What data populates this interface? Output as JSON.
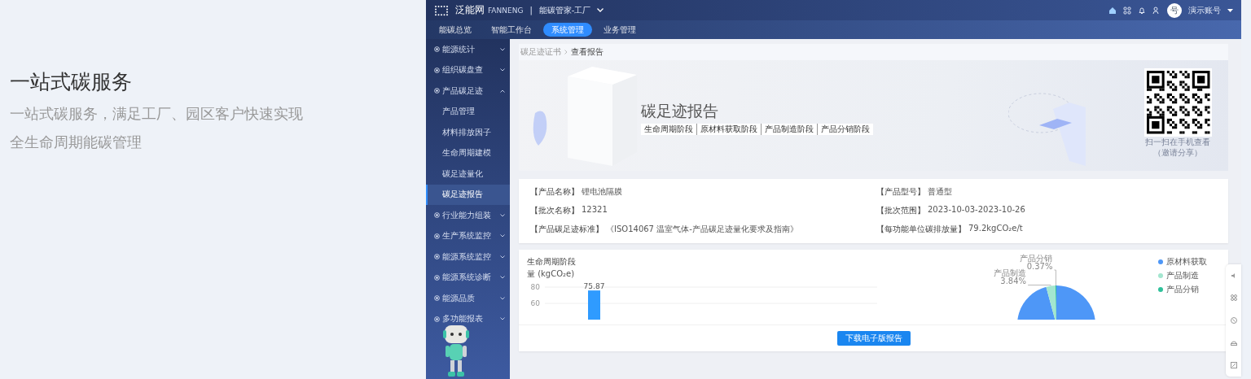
{
  "intro": {
    "title": "一站式碳服务",
    "description": "一站式碳服务，满足工厂、园区客户快速实现全生命周期能碳管理"
  },
  "app": {
    "top_bar": {
      "logo_text": "泛能网",
      "logo_subtitle": "FANNENG",
      "separator": "|",
      "workspace": "能碳管家-工厂",
      "avatar_text": "号",
      "account": "演示账号"
    },
    "nav_tabs": [
      {
        "label": "能碳总览",
        "selected": false
      },
      {
        "label": "智能工作台",
        "selected": false
      },
      {
        "label": "系统管理",
        "selected": true
      },
      {
        "label": "业务管理",
        "selected": false
      }
    ],
    "sidebar": {
      "items": [
        {
          "label": "能源统计",
          "expanded": false
        },
        {
          "label": "组织碳盘查",
          "expanded": false
        },
        {
          "label": "产品碳足迹",
          "expanded": true,
          "children": [
            {
              "label": "产品管理",
              "selected": false
            },
            {
              "label": "材料排放因子",
              "selected": false
            },
            {
              "label": "生命周期建模",
              "selected": false
            },
            {
              "label": "碳足迹量化",
              "selected": false
            },
            {
              "label": "碳足迹报告",
              "selected": true
            }
          ]
        },
        {
          "label": "行业能力组装",
          "expanded": false
        },
        {
          "label": "生产系统监控",
          "expanded": false
        },
        {
          "label": "能源系统监控",
          "expanded": false
        },
        {
          "label": "能源系统诊断",
          "expanded": false
        },
        {
          "label": "能源品质",
          "expanded": false
        },
        {
          "label": "多功能报表",
          "expanded": false
        }
      ]
    },
    "breadcrumb": [
      "碳足迹证书",
      "查看报告"
    ],
    "banner": {
      "title": "碳足迹报告",
      "stages": [
        "生命周期阶段",
        "原材料获取阶段",
        "产品制造阶段",
        "产品分销阶段"
      ],
      "qr_caption": "扫一扫在手机查看",
      "qr_subcaption": "（邀请分享）"
    },
    "info_fields": [
      {
        "label": "【产品名称】",
        "value": "锂电池隔膜"
      },
      {
        "label": "【产品型号】",
        "value": "普通型"
      },
      {
        "label": "【批次名称】",
        "value": "12321"
      },
      {
        "label": "【批次范围】",
        "value": "2023-10-03-2023-10-26"
      },
      {
        "label": "【产品碳足迹标准】",
        "value": "《ISO14067 温室气体-产品碳足迹量化要求及指南》"
      },
      {
        "label": "【每功能单位碳排放量】",
        "value": "79.2kgCO₂e/t"
      }
    ],
    "lifecycle_section": {
      "title": "生命周期阶段",
      "bar_chart": {
        "chart_data": {
          "type": "bar",
          "ylabel": "量 (kgCO₂e)",
          "values": [
            75.87
          ],
          "ylim": [
            40,
            80
          ],
          "yticks": [
            60,
            80
          ],
          "data_labels": true
        }
      },
      "pie_chart": {
        "chart_data": {
          "type": "pie",
          "categories": [
            "原材料获取",
            "产品制造",
            "产品分销"
          ],
          "values": [
            95.79,
            3.84,
            0.37
          ],
          "colors": [
            "#4e97f7",
            "#a3e6cf",
            "#2fc19a"
          ],
          "value_labels": [
            null,
            "3.84%",
            "0.37%"
          ]
        }
      }
    },
    "download_button": "下载电子版报告"
  }
}
